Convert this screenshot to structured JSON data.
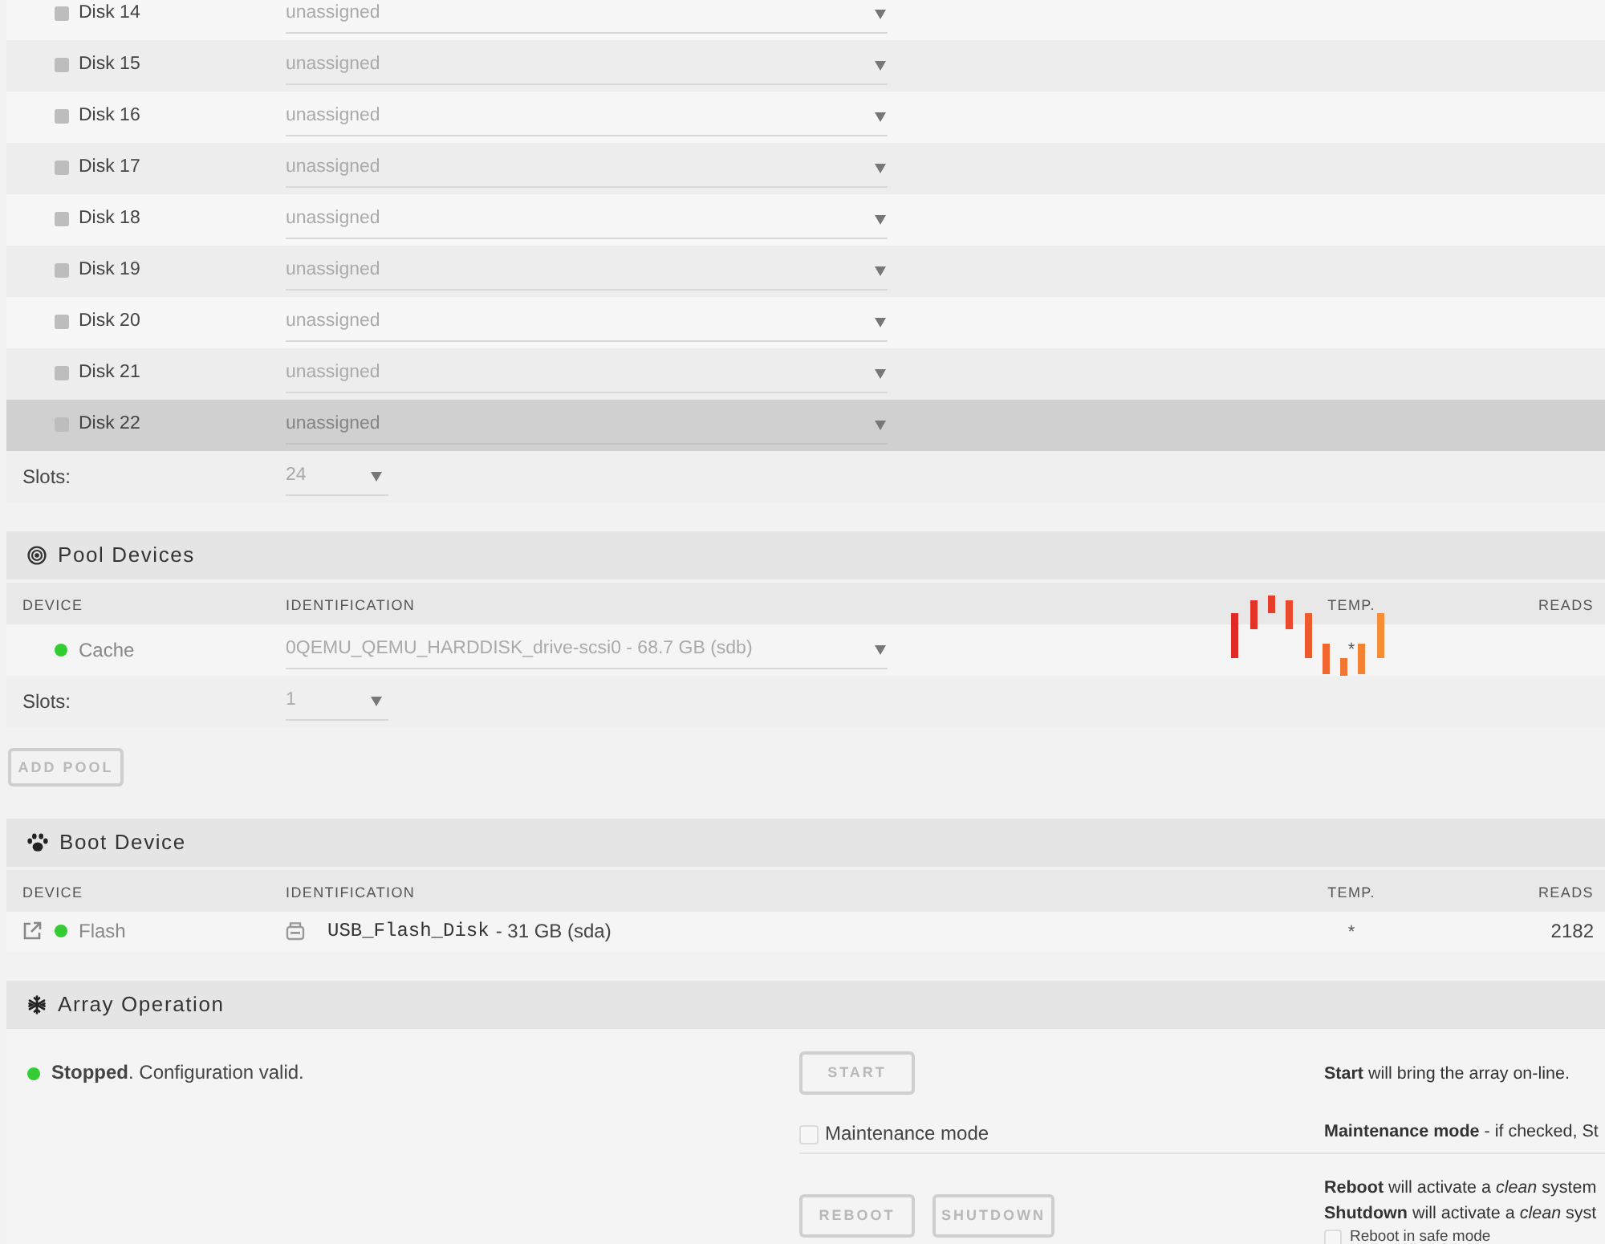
{
  "loading": true,
  "disks": [
    {
      "name": "Disk 14",
      "online": false,
      "assignment": "unassigned",
      "highlighted": false
    },
    {
      "name": "Disk 15",
      "online": false,
      "assignment": "unassigned",
      "highlighted": false
    },
    {
      "name": "Disk 16",
      "online": false,
      "assignment": "unassigned",
      "highlighted": false
    },
    {
      "name": "Disk 17",
      "online": false,
      "assignment": "unassigned",
      "highlighted": false
    },
    {
      "name": "Disk 18",
      "online": false,
      "assignment": "unassigned",
      "highlighted": false
    },
    {
      "name": "Disk 19",
      "online": false,
      "assignment": "unassigned",
      "highlighted": false
    },
    {
      "name": "Disk 20",
      "online": false,
      "assignment": "unassigned",
      "highlighted": false
    },
    {
      "name": "Disk 21",
      "online": false,
      "assignment": "unassigned",
      "highlighted": false
    },
    {
      "name": "Disk 22",
      "online": false,
      "assignment": "unassigned",
      "highlighted": true
    }
  ],
  "array_slots": {
    "label": "Slots:",
    "value": "24"
  },
  "pool_devices": {
    "title": "Pool Devices",
    "columns": [
      "DEVICE",
      "IDENTIFICATION",
      "TEMP.",
      "READS"
    ],
    "rows": [
      {
        "name": "Cache",
        "online": true,
        "identification": "0QEMU_QEMU_HARDDISK_drive-scsi0 - 68.7 GB (sdb)",
        "temp": "*"
      }
    ],
    "slots": {
      "label": "Slots:",
      "value": "1"
    },
    "add_button": "ADD POOL"
  },
  "boot_device": {
    "title": "Boot Device",
    "columns": [
      "DEVICE",
      "IDENTIFICATION",
      "TEMP.",
      "READS"
    ],
    "rows": [
      {
        "name": "Flash",
        "online": true,
        "device_id": "USB_Flash_Disk",
        "size": "- 31 GB (sda)",
        "temp": "*",
        "reads": "2182"
      }
    ]
  },
  "array_operation": {
    "title": "Array Operation",
    "status": {
      "valid": true,
      "text": "**Stopped**. Configuration valid."
    },
    "start_button": "START",
    "maintenance": {
      "label": "Maintenance mode",
      "checked": false
    },
    "reboot_button": "REBOOT",
    "shutdown_button": "SHUTDOWN",
    "help": [
      "**Start** will bring the array on-line.",
      "**Maintenance mode** - if checked, St",
      "**Reboot** will activate a *clean* system",
      "**Shutdown** will activate a *clean* syst"
    ],
    "safe_mode": {
      "label": "Reboot in safe mode",
      "checked": false
    }
  }
}
